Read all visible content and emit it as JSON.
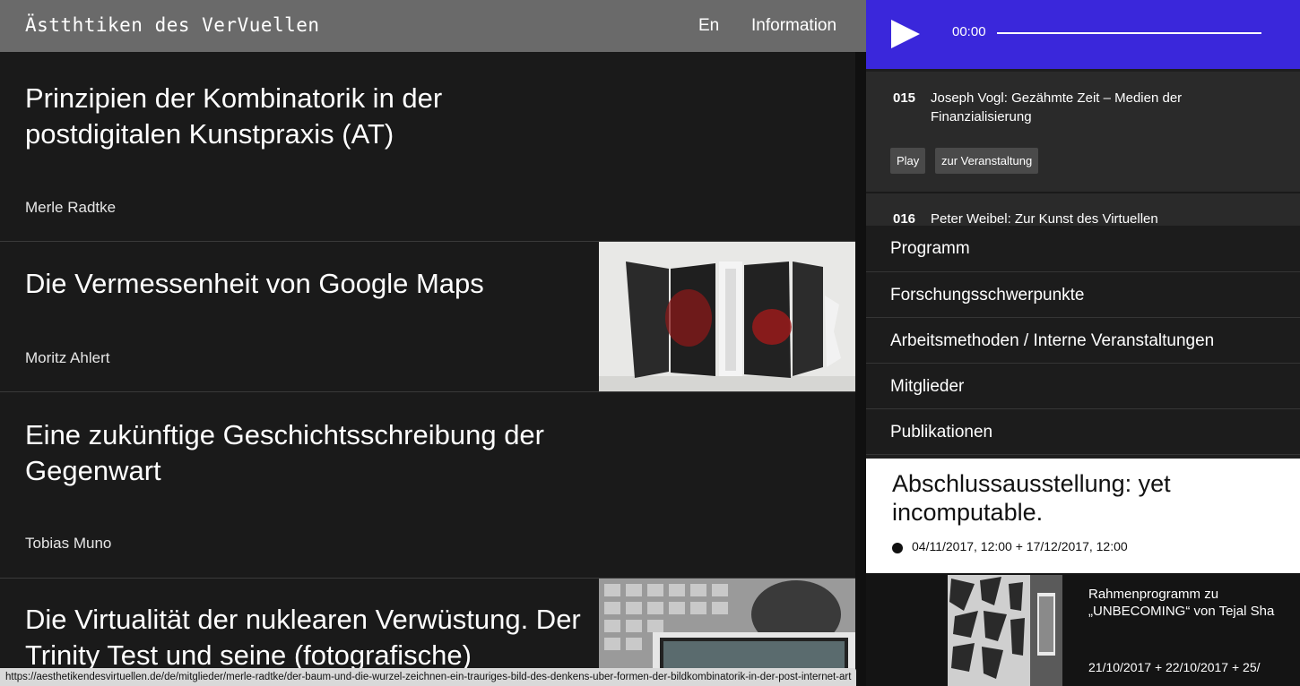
{
  "header": {
    "site_title": "Ästthtiken des VerVuellen",
    "lang": "En",
    "info": "Information"
  },
  "articles": [
    {
      "title": "Prinzipien der Kombinatorik in der postdigitalen Kunstpraxis (AT)",
      "author": "Merle Radtke"
    },
    {
      "title": "Die Vermessenheit von Google Maps",
      "author": "Moritz Ahlert"
    },
    {
      "title": "Eine zukünftige Geschichtsschreibung der Gegenwart",
      "author": "Tobias Muno"
    },
    {
      "title": "Die Virtualität der nuklearen Verwüstung. Der Trinity Test und seine (fotografische)",
      "author": ""
    }
  ],
  "player": {
    "time": "00:00",
    "progress": 0
  },
  "playlist": [
    {
      "number": "015",
      "title": "Joseph Vogl: Gezähmte Zeit – Medien der Finanzialisierung",
      "play_label": "Play",
      "event_label": "zur Veranstaltung"
    },
    {
      "number": "016",
      "title": "Peter Weibel: Zur Kunst des Virtuellen"
    }
  ],
  "nav": [
    "Programm",
    "Forschungsschwerpunkte",
    "Arbeitsmethoden / Interne Veranstaltungen",
    "Mitglieder",
    "Publikationen"
  ],
  "event": {
    "title": "Abschlussausstellung: yet incomputable.",
    "date": "04/11/2017, 12:00  + 17/12/2017, 12:00"
  },
  "event2": {
    "title_line1": "Rahmenprogramm zu",
    "title_line2": "„UNBECOMING“ von Tejal Sha",
    "date": "21/10/2017  + 22/10/2017  + 25/"
  },
  "status_url": "https://aesthetikendesvirtuellen.de/de/mitglieder/merle-radtke/der-baum-und-die-wurzel-zeichnen-ein-trauriges-bild-des-denkens-uber-formen-der-bildkombinatorik-in-der-post-internet-art"
}
